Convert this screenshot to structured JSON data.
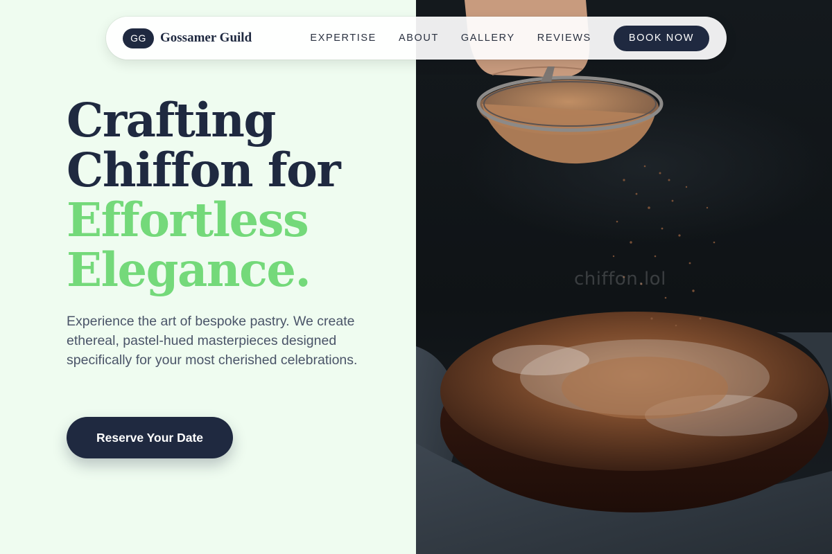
{
  "nav": {
    "logo_initials": "GG",
    "brand_name": "Gossamer Guild",
    "links": [
      {
        "label": "EXPERTISE"
      },
      {
        "label": "ABOUT"
      },
      {
        "label": "GALLERY"
      },
      {
        "label": "REVIEWS"
      }
    ],
    "cta_label": "BOOK NOW"
  },
  "hero": {
    "headline_line1": "Crafting",
    "headline_line2": "Chiffon for",
    "headline_line3": "Effortless",
    "headline_line4": "Elegance.",
    "description": "Experience the art of bespoke pastry. We create ethereal, pastel-hued masterpieces designed specifically for your most cherished celebrations.",
    "cta_label": "Reserve Your Date"
  },
  "image": {
    "watermark": "chiffon.lol"
  },
  "colors": {
    "accent_dark": "#1f2940",
    "accent_green": "#74d97a",
    "background": "#effcf0"
  }
}
